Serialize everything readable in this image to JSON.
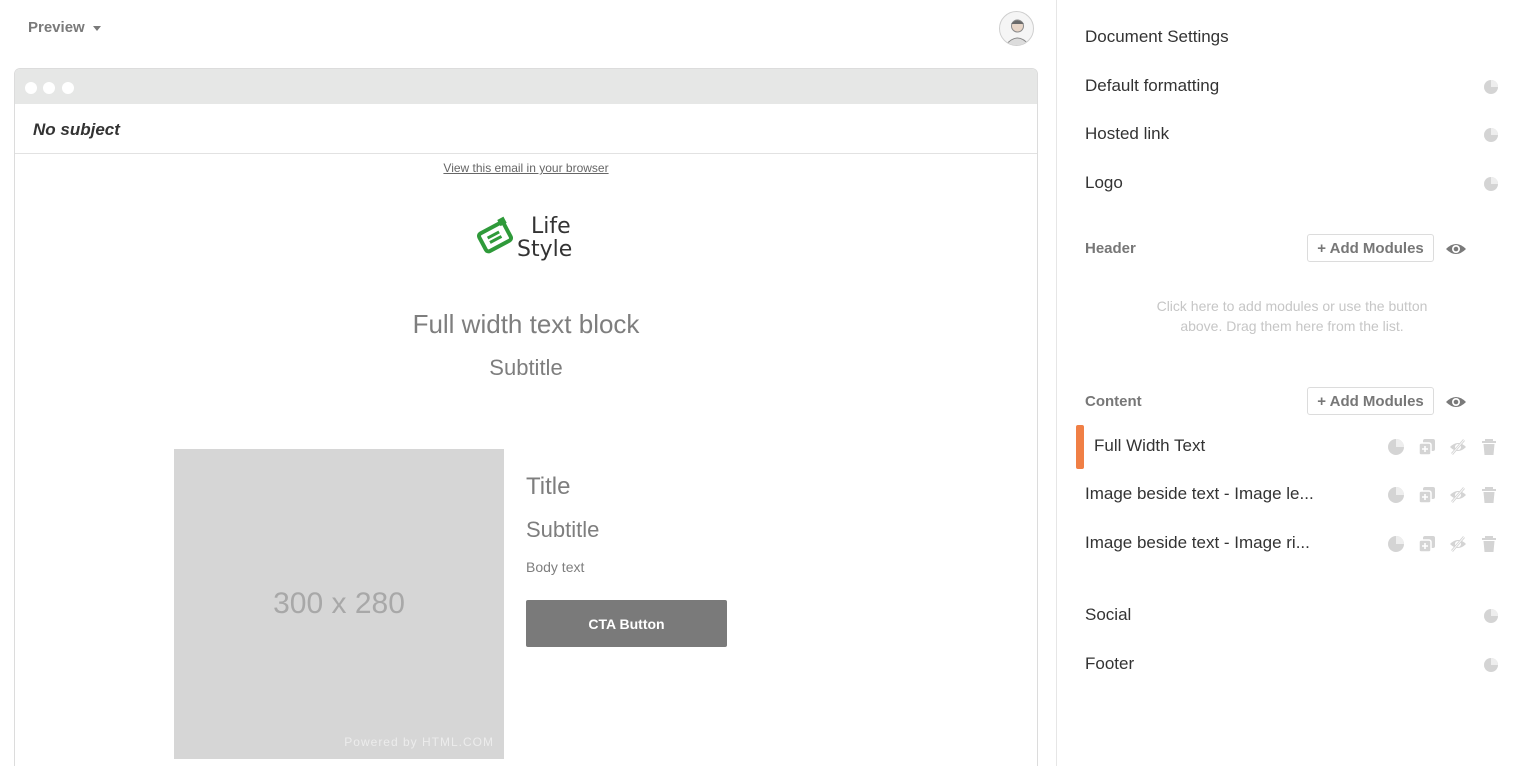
{
  "topbar": {
    "preview_label": "Preview",
    "avatar_icon": "user-avatar-icon"
  },
  "preview": {
    "subject": "No subject",
    "view_in_browser": "View this email in your browser",
    "logo_text_line1": "Life",
    "logo_text_line2": "Style",
    "full_width_title": "Full width text block",
    "full_width_subtitle": "Subtitle",
    "image_placeholder": "300 x 280",
    "image_watermark": "Powered by HTML.COM",
    "image_text_title": "Title",
    "image_text_subtitle": "Subtitle",
    "image_text_body": "Body text",
    "cta_label": "CTA Button"
  },
  "settings": {
    "title": "Document Settings",
    "rows": [
      {
        "label": "Default formatting",
        "icon": "pie-chart-icon"
      },
      {
        "label": "Hosted link",
        "icon": "pie-chart-icon"
      },
      {
        "label": "Logo",
        "icon": "pie-chart-icon"
      }
    ],
    "header": {
      "label": "Header",
      "add_button": "+ Add Modules",
      "hint_line1": "Click here to add modules or use the button",
      "hint_line2": "above. Drag them here from the list."
    },
    "content": {
      "label": "Content",
      "add_button": "+ Add Modules",
      "modules": [
        {
          "label": "Full Width Text",
          "active": true
        },
        {
          "label": "Image beside text - Image le...",
          "active": false
        },
        {
          "label": "Image beside text - Image ri...",
          "active": false
        }
      ]
    },
    "bottom_rows": [
      {
        "label": "Social",
        "icon": "pie-chart-icon"
      },
      {
        "label": "Footer",
        "icon": "pie-chart-icon"
      }
    ]
  },
  "colors": {
    "accent": "#f07f45",
    "cta": "#7a7a7a",
    "placeholder": "#d6d6d6",
    "logo_green": "#2f9a3a"
  }
}
